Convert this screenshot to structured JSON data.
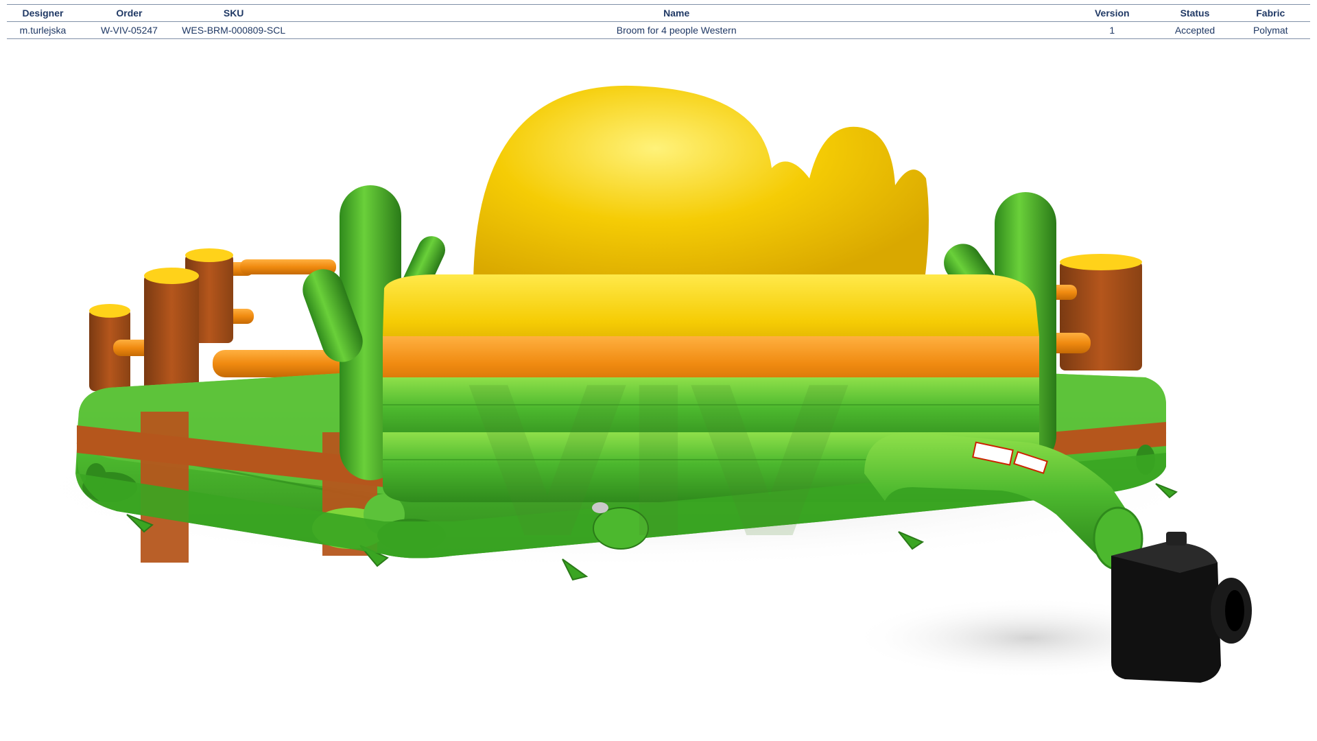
{
  "spec_table": {
    "headers": {
      "designer": "Designer",
      "order": "Order",
      "sku": "SKU",
      "name": "Name",
      "version": "Version",
      "status": "Status",
      "fabric": "Fabric"
    },
    "row": {
      "designer": "m.turlejska",
      "order": "W-VIV-05247",
      "sku": "WES-BRM-000809-SCL",
      "name": "Broom for 4 people Western",
      "version": "1",
      "status": "Accepted",
      "fabric": "Polymat"
    }
  },
  "render": {
    "watermark": "VIV",
    "colors": {
      "green": "#4cb82e",
      "green_dark": "#2f8a1c",
      "green_light": "#8fe04a",
      "orange": "#f08a10",
      "brown": "#b5561c",
      "brown_dark": "#7a3a12",
      "yellow": "#f5cc05",
      "yellow_dark": "#d9a800",
      "blower": "#111111"
    }
  }
}
